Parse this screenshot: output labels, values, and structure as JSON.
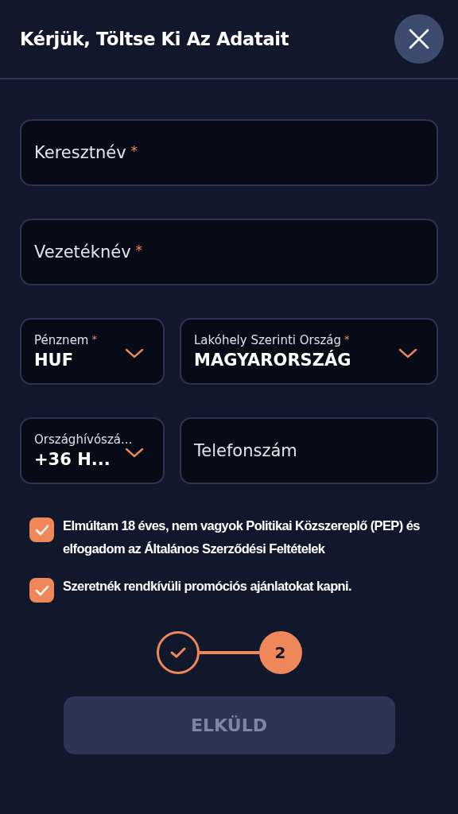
{
  "header": {
    "title": "Kérjük, Töltse Ki Az Adatait"
  },
  "rows": [
    [
      {
        "kind": "text",
        "placeholder": "Keresztnév",
        "required_mark": "*"
      }
    ],
    [
      {
        "kind": "text",
        "placeholder": "Vezetéknév",
        "required_mark": "*"
      }
    ],
    [
      {
        "kind": "select",
        "label": "Pénznem",
        "required_mark": "*",
        "value": "HUF"
      },
      {
        "kind": "select",
        "label": "Lakóhely Szerinti Ország",
        "required_mark": "*",
        "value": "MAGYARORSZÁG"
      }
    ],
    [
      {
        "kind": "select",
        "label": "Országhívószá...",
        "value": "+36 H..."
      },
      {
        "kind": "text",
        "placeholder": "Telefonszám"
      }
    ]
  ],
  "checkboxes": [
    {
      "label": "Elmúltam 18 éves, nem vagyok Politikai Közszereplő (PEP) és elfogadom az Általános Szerződési Feltételek",
      "checked": true
    },
    {
      "label": "Szeretnék rendkívüli promóciós ajánlatokat kapni.",
      "checked": true
    }
  ],
  "steps": [
    {
      "done": true
    },
    {
      "done": false,
      "number": "2"
    }
  ],
  "submit": {
    "label": "ELKÜLD",
    "disabled": true
  }
}
